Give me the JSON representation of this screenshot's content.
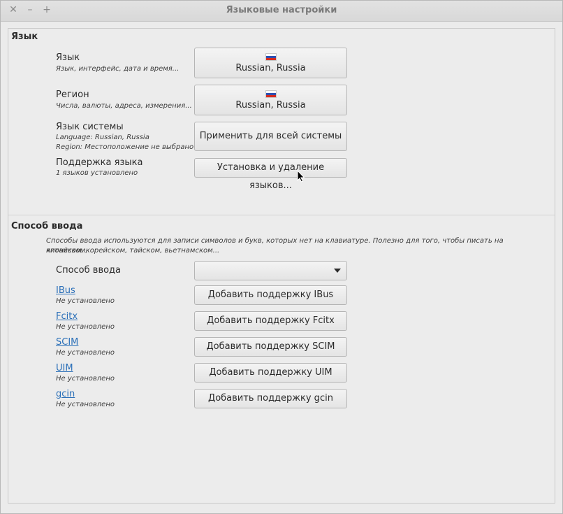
{
  "window": {
    "title": "Языковые настройки",
    "close_glyph": "✕",
    "minimize_glyph": "–",
    "maximize_glyph": "+"
  },
  "language_section": {
    "title": "Язык",
    "language": {
      "label": "Язык",
      "sub": "Язык, интерфейс, дата и время...",
      "button": "Russian, Russia",
      "flag_icon": "russia-flag-icon"
    },
    "region": {
      "label": "Регион",
      "sub": "Числа, валюты, адреса, измерения...",
      "button": "Russian, Russia",
      "flag_icon": "russia-flag-icon"
    },
    "system_language": {
      "label": "Язык системы",
      "sub1": "Language: Russian, Russia",
      "sub2": "Region: Местоположение не выбрано",
      "button": "Применить для всей системы"
    },
    "language_support": {
      "label": "Поддержка языка",
      "sub": "1 языков установлено",
      "button": "Установка и удаление языков..."
    }
  },
  "input_section": {
    "title": "Способ ввода",
    "description_line1": "Способы ввода используются для записи символов и букв, которых нет на клавиатуре. Полезно для того, чтобы писать на китайском,",
    "description_line2": "японском, корейском, тайском, вьетнамском...",
    "input_method": {
      "label": "Способ ввода",
      "selected": ""
    },
    "methods": [
      {
        "name": "IBus",
        "status": "Не установлено",
        "button": "Добавить поддержку IBus"
      },
      {
        "name": "Fcitx",
        "status": "Не установлено",
        "button": "Добавить поддержку Fcitx"
      },
      {
        "name": "SCIM",
        "status": "Не установлено",
        "button": "Добавить поддержку SCIM"
      },
      {
        "name": "UIM",
        "status": "Не установлено",
        "button": "Добавить поддержку UIM"
      },
      {
        "name": "gcin",
        "status": "Не установлено",
        "button": "Добавить поддержку gcin"
      }
    ]
  },
  "colors": {
    "link": "#2a6fb8",
    "background": "#ececec"
  }
}
